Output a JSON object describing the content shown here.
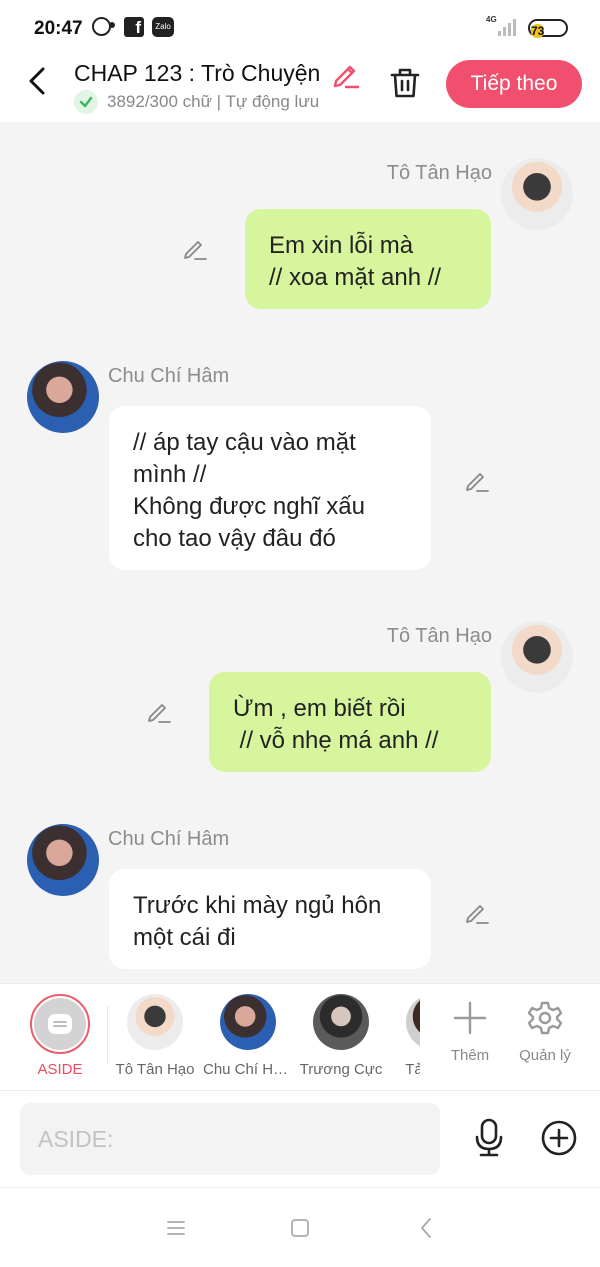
{
  "status_bar": {
    "time": "20:47",
    "network": "4G",
    "battery": "73",
    "battery_level": 0.73,
    "battery_color": "#f2c21b",
    "icons": [
      "message-bubble-icon",
      "facebook-icon",
      "zalo-icon",
      "signal-icon",
      "battery-icon"
    ],
    "facebook_glyph": "f",
    "zalo_glyph": "Zalo"
  },
  "header": {
    "title": "CHAP 123 : Trò Chuyện",
    "word_count": "3892/300 chữ | Tự động lưu",
    "next_button": "Tiếp theo",
    "accent": "#f0506e"
  },
  "messages": [
    {
      "side": "out",
      "sender": "Tô Tân Hạo",
      "lines": [
        "Em xin lỗi mà",
        "// xoa mặt anh //"
      ]
    },
    {
      "side": "in",
      "sender": "Chu Chí Hâm",
      "lines": [
        "// áp tay cậu vào mặt",
        "mình //",
        "Không được nghĩ xấu",
        "cho tao vậy đâu đó"
      ]
    },
    {
      "side": "out",
      "sender": "Tô Tân Hạo",
      "lines": [
        "Ừm , em biết rồi",
        " // vỗ nhẹ má anh //"
      ]
    },
    {
      "side": "in",
      "sender": "Chu Chí Hâm",
      "lines": [
        "Trước khi mày ngủ hôn",
        "một cái đi"
      ]
    }
  ],
  "characters": {
    "aside": "ASIDE",
    "list": [
      "Tô Tân Hạo",
      "Chu Chí Hâm",
      "Trương Cực",
      "Tả Hàng"
    ],
    "add": "Thêm",
    "manage": "Quản lý"
  },
  "input": {
    "placeholder": "ASIDE:"
  },
  "colors": {
    "outgoing_bubble": "#d6f59d",
    "incoming_bubble": "#ffffff",
    "aside_accent": "#ef4a60"
  }
}
